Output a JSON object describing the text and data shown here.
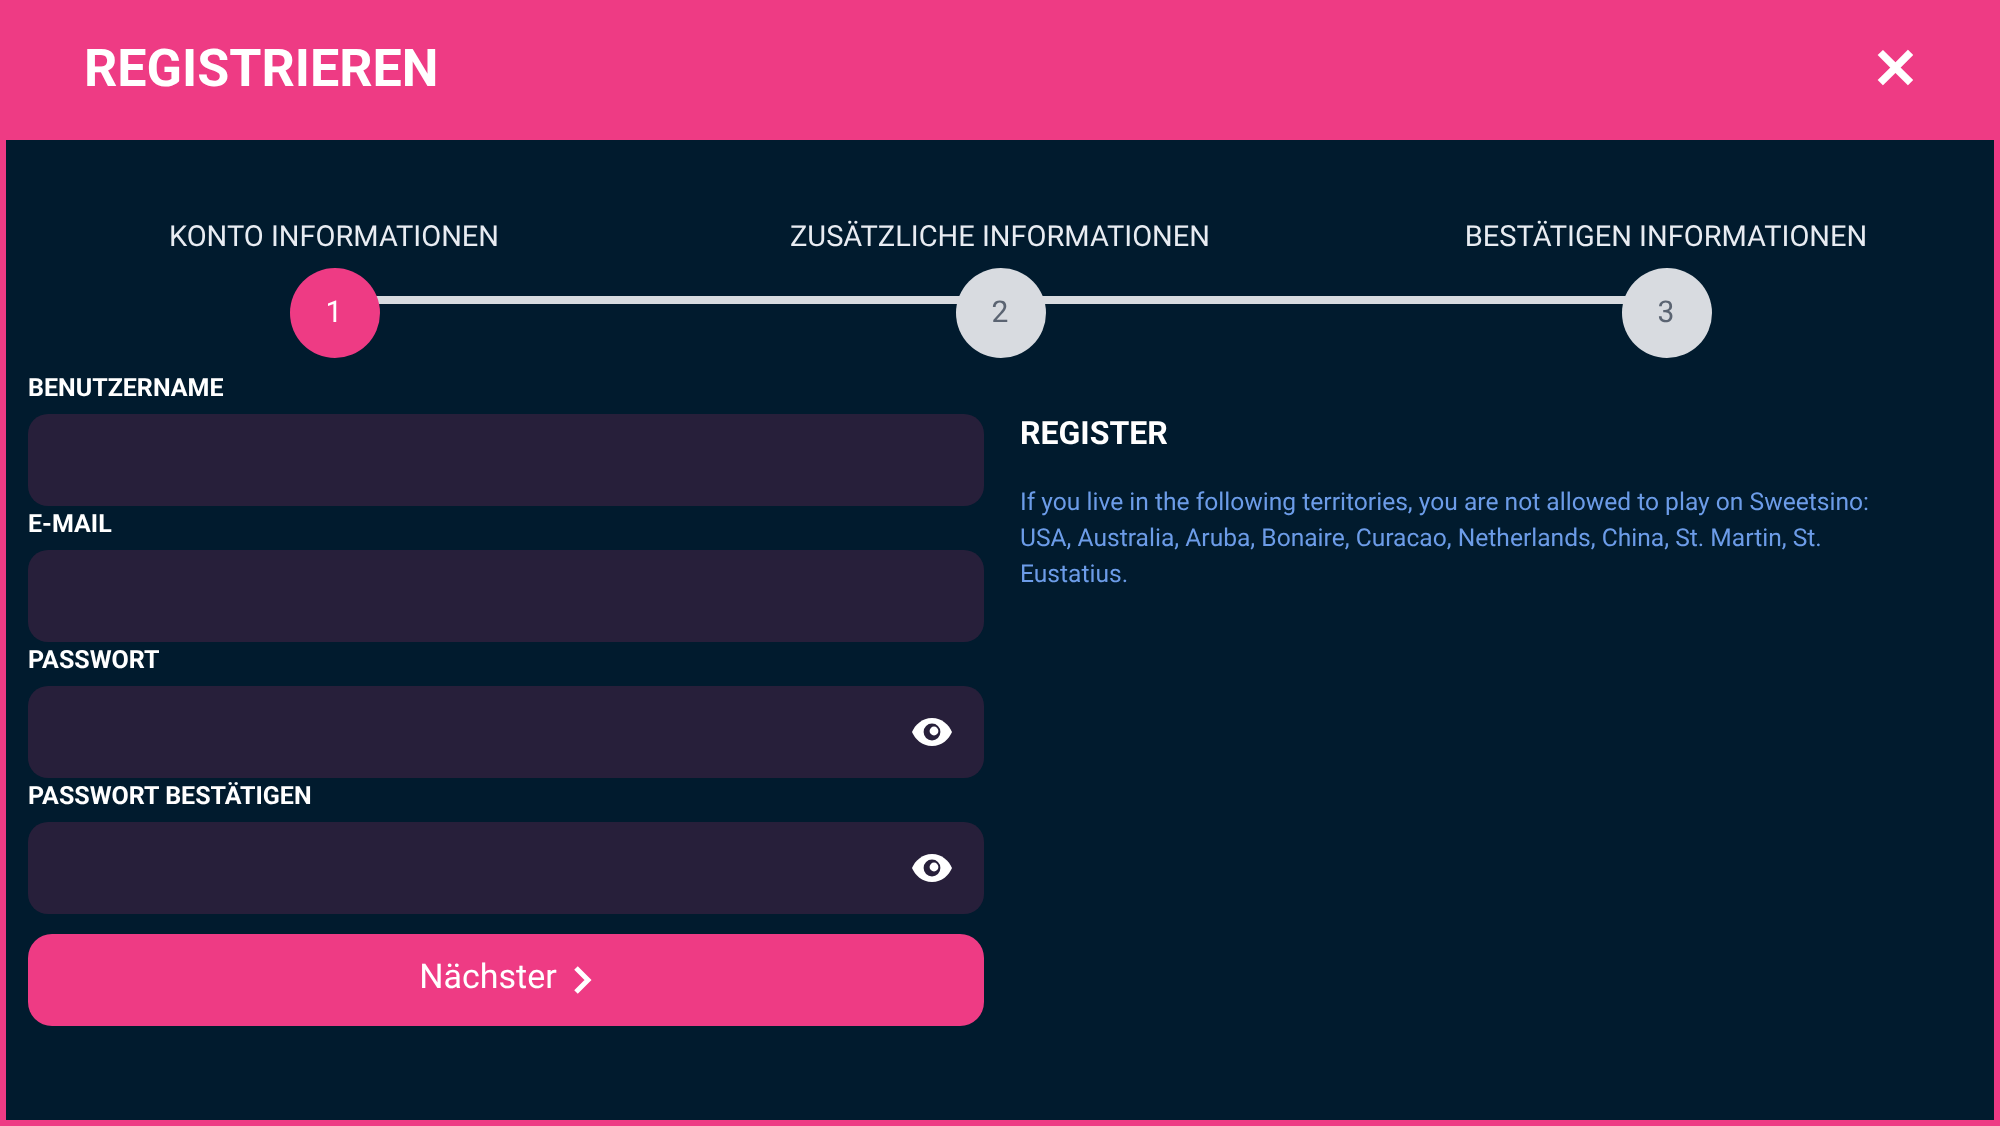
{
  "dialog": {
    "title": "REGISTRIEREN",
    "close": "✕"
  },
  "steps": [
    {
      "label": "KONTO INFORMATIONEN",
      "number": "1",
      "selected": true
    },
    {
      "label": "ZUSÄTZLICHE INFORMATIONEN",
      "number": "2",
      "selected": false
    },
    {
      "label": "BESTÄTIGEN INFORMATIONEN",
      "number": "3",
      "selected": false
    }
  ],
  "fields": [
    {
      "label": "BENUTZERNAME",
      "kind": "text"
    },
    {
      "label": "E-MAIL",
      "kind": "text"
    },
    {
      "label": "PASSWORT",
      "kind": "password"
    },
    {
      "label": "PASSWORT BESTÄTIGEN",
      "kind": "password"
    }
  ],
  "next_button": "Nächster",
  "info": {
    "heading": "REGISTER",
    "text": "If you live in the following territories, you are not allowed to play on Sweetsino: USA, Australia, Aruba, Bonaire, Curacao, Netherlands, China, St. Martin, St. Eustatius."
  }
}
